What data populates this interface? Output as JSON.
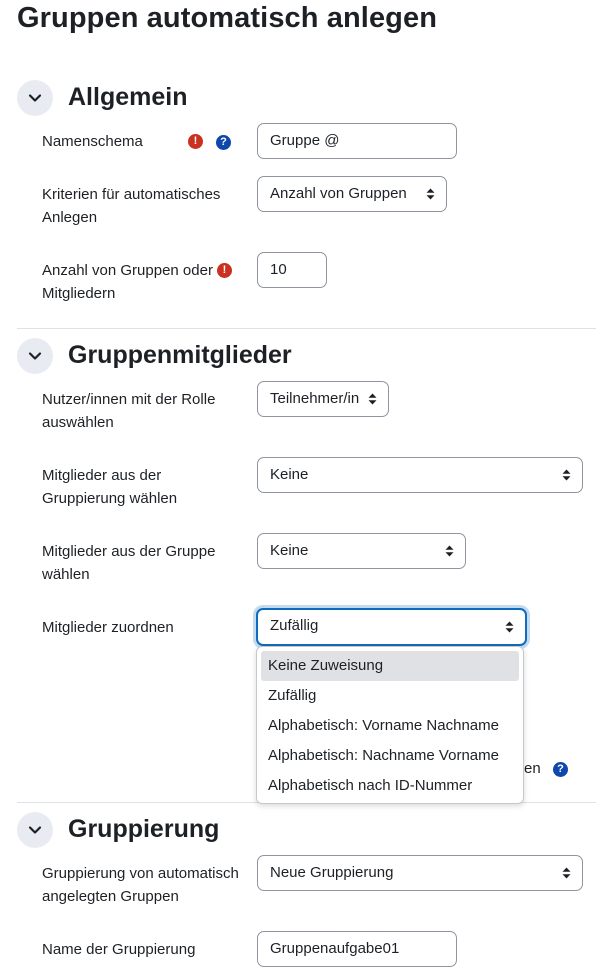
{
  "page": {
    "title": "Gruppen automatisch anlegen"
  },
  "sections": {
    "general": {
      "title": "Allgemein",
      "naming_scheme": {
        "label": "Namenschema",
        "value": "Gruppe @"
      },
      "criteria": {
        "label": "Kriterien für automatisches Anlegen",
        "value": "Anzahl von Gruppen"
      },
      "count": {
        "label": "Anzahl von Gruppen oder Mitgliedern",
        "value": "10"
      }
    },
    "members": {
      "title": "Gruppenmitglieder",
      "role": {
        "label": "Nutzer/innen mit der Rolle auswählen",
        "value": "Teilnehmer/in"
      },
      "from_grouping": {
        "label": "Mitglieder aus der Gruppierung wählen",
        "value": "Keine"
      },
      "from_group": {
        "label": "Mitglieder aus der Gruppe wählen",
        "value": "Keine"
      },
      "allocate": {
        "label": "Mitglieder zuordnen",
        "value": "Zufällig",
        "options": [
          "Keine Zuweisung",
          "Zufällig",
          "Alphabetisch: Vorname Nachname",
          "Alphabetisch: Nachname Vorname",
          "Alphabetisch nach ID-Nummer"
        ],
        "highlighted_option": "Keine Zuweisung"
      },
      "hidden_row_partial_text": "en"
    },
    "grouping": {
      "title": "Gruppierung",
      "grouping_select": {
        "label": "Gruppierung von automatisch angelegten Gruppen",
        "value": "Neue Gruppierung"
      },
      "grouping_name": {
        "label": "Name der Gruppierung",
        "value": "Gruppenaufgabe01"
      }
    }
  },
  "icons": {
    "required": "exclamation-circle-icon",
    "help": "question-circle-icon",
    "section_toggle": "chevron-down-icon",
    "select_caret": "sort-caret-icon"
  },
  "colors": {
    "required": "#ca3120",
    "help": "#0f47ad",
    "focus": "#0f6cbf",
    "toggle_bg": "#e8ecf2"
  }
}
